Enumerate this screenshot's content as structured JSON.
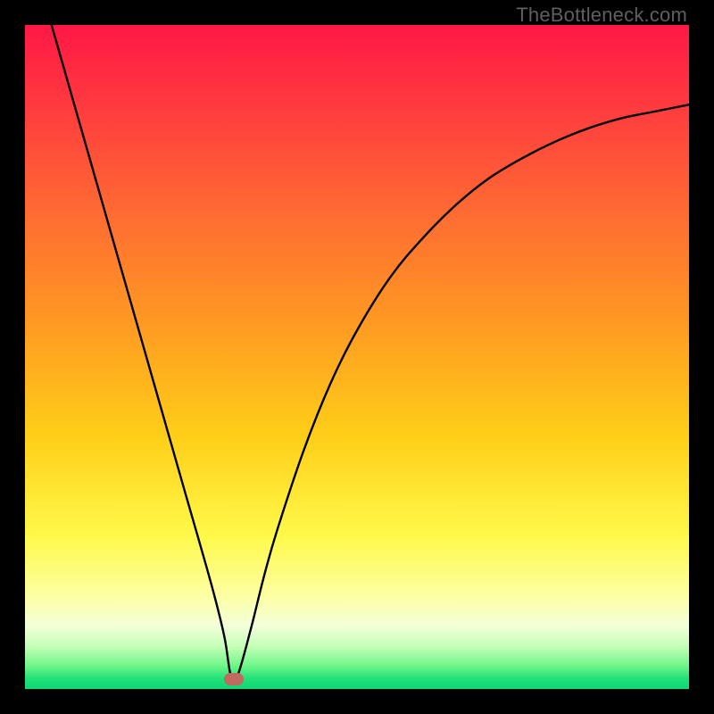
{
  "watermark": "TheBottleneck.com",
  "chart_data": {
    "type": "line",
    "title": "",
    "xlabel": "",
    "ylabel": "",
    "xlim": [
      0,
      100
    ],
    "ylim": [
      0,
      100
    ],
    "series": [
      {
        "name": "curve",
        "x": [
          4,
          8,
          12,
          16,
          20,
          24,
          28,
          30,
          31,
          32,
          34,
          36,
          38,
          42,
          46,
          50,
          55,
          60,
          65,
          70,
          75,
          80,
          85,
          90,
          95,
          100
        ],
        "y": [
          100,
          86,
          72,
          58,
          44,
          30,
          16,
          8,
          2,
          2,
          9,
          17,
          24,
          36,
          46,
          54,
          62,
          68,
          73,
          77,
          80,
          82.5,
          84.5,
          86,
          87,
          88
        ]
      }
    ],
    "marker": {
      "x": 31.5,
      "y": 1.5,
      "color": "#c06a62"
    },
    "gradient_stops": [
      {
        "pos": 0.0,
        "color": "#ff1845"
      },
      {
        "pos": 0.12,
        "color": "#ff3a3f"
      },
      {
        "pos": 0.28,
        "color": "#ff6a33"
      },
      {
        "pos": 0.45,
        "color": "#ff9a22"
      },
      {
        "pos": 0.62,
        "color": "#ffcf18"
      },
      {
        "pos": 0.77,
        "color": "#fff94a"
      },
      {
        "pos": 0.86,
        "color": "#fdffa3"
      },
      {
        "pos": 0.905,
        "color": "#f3ffda"
      },
      {
        "pos": 0.935,
        "color": "#c7ffb8"
      },
      {
        "pos": 0.965,
        "color": "#70f58a"
      },
      {
        "pos": 0.985,
        "color": "#1fe077"
      },
      {
        "pos": 1.0,
        "color": "#0fd874"
      }
    ]
  }
}
